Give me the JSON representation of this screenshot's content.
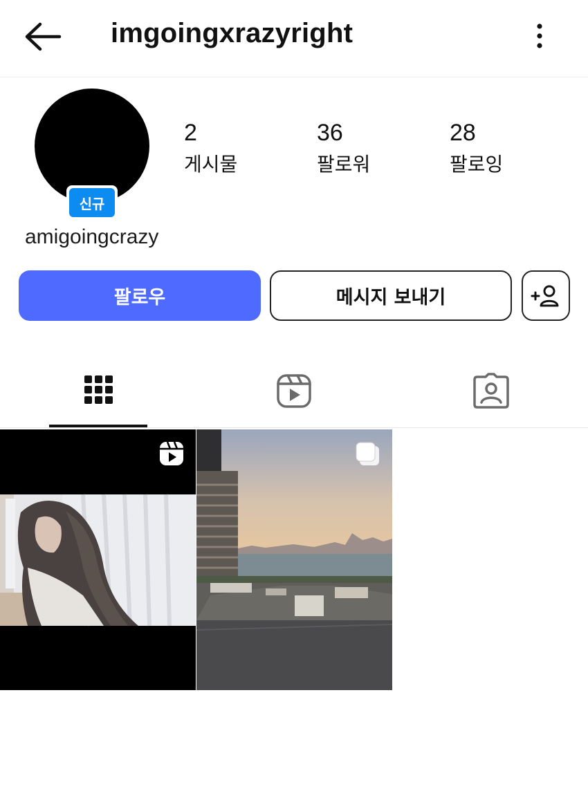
{
  "header": {
    "title": "imgoingxrazyright",
    "back_icon": "arrow-left-icon",
    "more_icon": "kebab-menu-icon"
  },
  "profile": {
    "username": "amigoingcrazy",
    "badge": "신규",
    "stats": [
      {
        "value": "2",
        "label": "게시물"
      },
      {
        "value": "36",
        "label": "팔로워"
      },
      {
        "value": "28",
        "label": "팔로잉"
      }
    ]
  },
  "actions": {
    "follow_label": "팔로우",
    "message_label": "메시지 보내기",
    "add_user_icon": "add-person-icon"
  },
  "tabs": [
    {
      "icon": "grid-icon",
      "active": true
    },
    {
      "icon": "reels-icon",
      "active": false
    },
    {
      "icon": "tagged-icon",
      "active": false
    }
  ],
  "posts": [
    {
      "type": "reel",
      "badge_icon": "reels-icon"
    },
    {
      "type": "carousel",
      "badge_icon": "carousel-icon"
    }
  ],
  "colors": {
    "follow_button": "#4f6bff",
    "badge": "#0c8bf0",
    "text": "#111111"
  }
}
